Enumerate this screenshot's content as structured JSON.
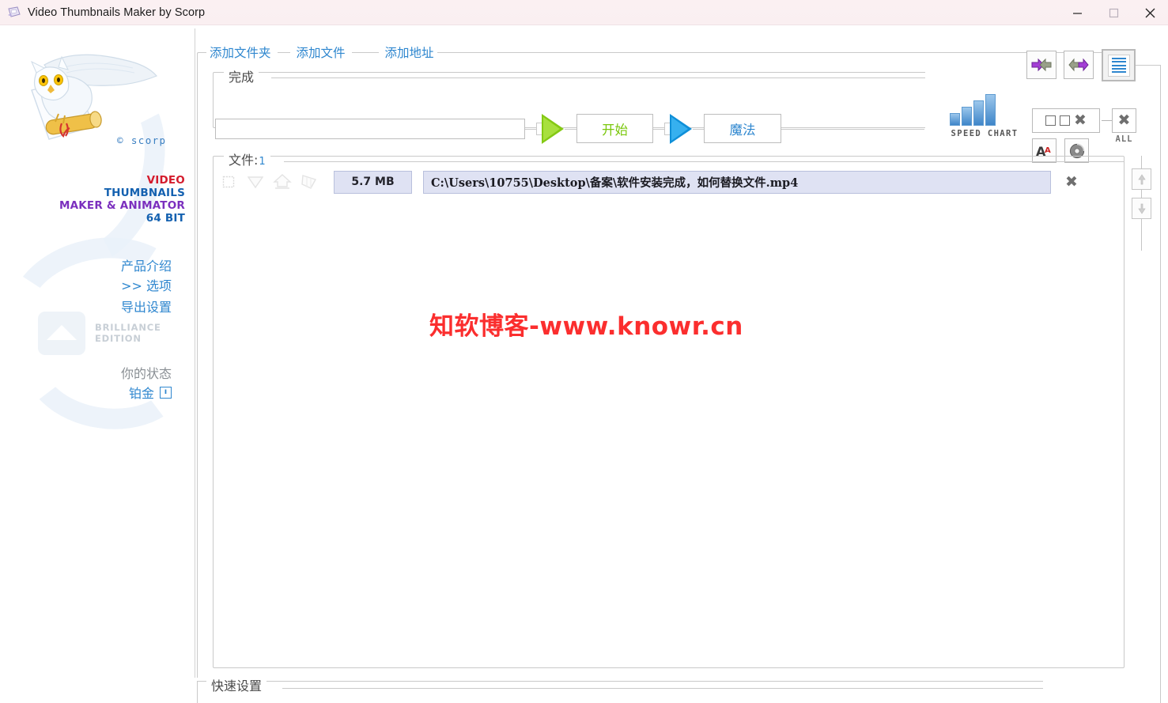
{
  "window": {
    "title": "Video Thumbnails Maker by Scorp",
    "app_icon": "app-window-icon",
    "controls": {
      "minimize": "—",
      "maximize": "□",
      "close": "✕"
    }
  },
  "sidebar": {
    "logo_icon": "snowy-owl-scroll-logo",
    "copyright": "© scorp",
    "product_name": {
      "line1": "VIDEO",
      "line2": "THUMBNAILS",
      "line3": "MAKER & ANIMATOR",
      "line4": "64 BIT"
    },
    "links": [
      {
        "id": "intro",
        "label": "产品介绍"
      },
      {
        "id": "option",
        "label": ">> 选项"
      },
      {
        "id": "export",
        "label": "导出设置"
      }
    ],
    "edition": {
      "line1": "BRILLIANCE",
      "line2": "EDITION",
      "icon": "mountain-triangle-icon"
    },
    "status": {
      "label": "你的状态",
      "value": "铂金",
      "info_icon": "info-icon",
      "info_glyph": "ı"
    }
  },
  "source_tabs": [
    {
      "id": "add-folder",
      "label": "添加文件夹"
    },
    {
      "id": "add-file",
      "label": "添加文件"
    },
    {
      "id": "add-address",
      "label": "添加地址"
    }
  ],
  "toolbar": {
    "import_icon": "import-arrows-icon",
    "export_icon": "export-arrows-icon",
    "list_icon": "list-view-icon"
  },
  "done_panel": {
    "legend": "完成",
    "progress_value": "",
    "start_button": "开始",
    "magic_button": "魔法",
    "green_arrow_icon": "play-arrow-green-icon",
    "blue_arrow_icon": "play-arrow-blue-icon"
  },
  "speed_chart": {
    "label": "SPEED CHART",
    "icon": "bar-chart-icon",
    "bars": [
      16,
      24,
      32,
      40
    ]
  },
  "right_tools": {
    "close_selected_icon": "close-selected-icon",
    "close_all_icon": "close-all-icon",
    "close_all_label": "ALL",
    "font_icon": "font-size-icon",
    "font_glyph": "A",
    "disc_icon": "disc-icon"
  },
  "files_panel": {
    "legend": "文件:",
    "count": "1",
    "row_icons": [
      "checkbox-icon",
      "shield-icon",
      "house-icon",
      "layers-icon"
    ],
    "rows": [
      {
        "size": "5.7 MB",
        "path": "C:\\Users\\10755\\Desktop\\备案\\软件安装完成，如何替换文件.mp4",
        "delete_icon": "remove-icon"
      }
    ],
    "move_up_icon": "arrow-up-icon",
    "move_down_icon": "arrow-down-icon"
  },
  "watermark": {
    "text": "知软博客-www.knowr.cn",
    "color": "#fb2e2e"
  },
  "quick_settings": {
    "legend": "快速设置"
  },
  "colors": {
    "link_blue": "#2f87cf",
    "start_green": "#7ac70c",
    "accent_red": "#d41b2c",
    "purple": "#7b2fbe",
    "field_lavender": "#dfe2f3",
    "titlebar": "#fbf0f2"
  }
}
